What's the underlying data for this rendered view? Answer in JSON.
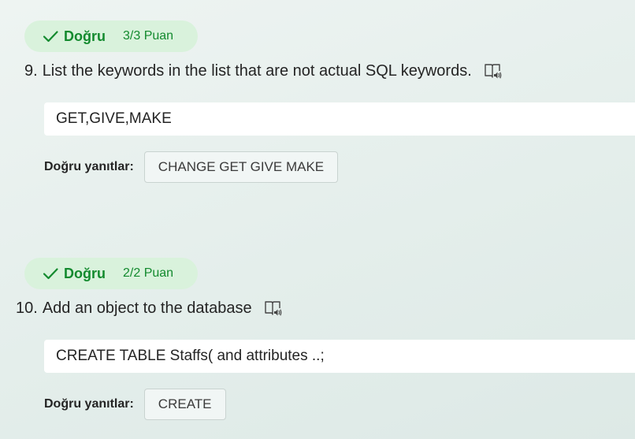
{
  "questions": [
    {
      "status": "Doğru",
      "points": "3/3 Puan",
      "number": "9.",
      "text": "List the keywords in the list that are not actual SQL keywords.",
      "answer": "GET,GIVE,MAKE",
      "correct_label": "Doğru yanıtlar:",
      "correct_answer": "CHANGE GET GIVE MAKE"
    },
    {
      "status": "Doğru",
      "points": "2/2 Puan",
      "number": "10.",
      "text": "Add an object to the database",
      "answer": "CREATE TABLE Staffs( and attributes ..;",
      "correct_label": "Doğru yanıtlar:",
      "correct_answer": "CREATE"
    }
  ],
  "icons": {
    "status_icon": "checkmark-icon",
    "reader_icon": "immersive-reader-icon"
  },
  "colors": {
    "success": "#138a2e",
    "success_bg": "#d9f2dc",
    "text": "#242424"
  }
}
